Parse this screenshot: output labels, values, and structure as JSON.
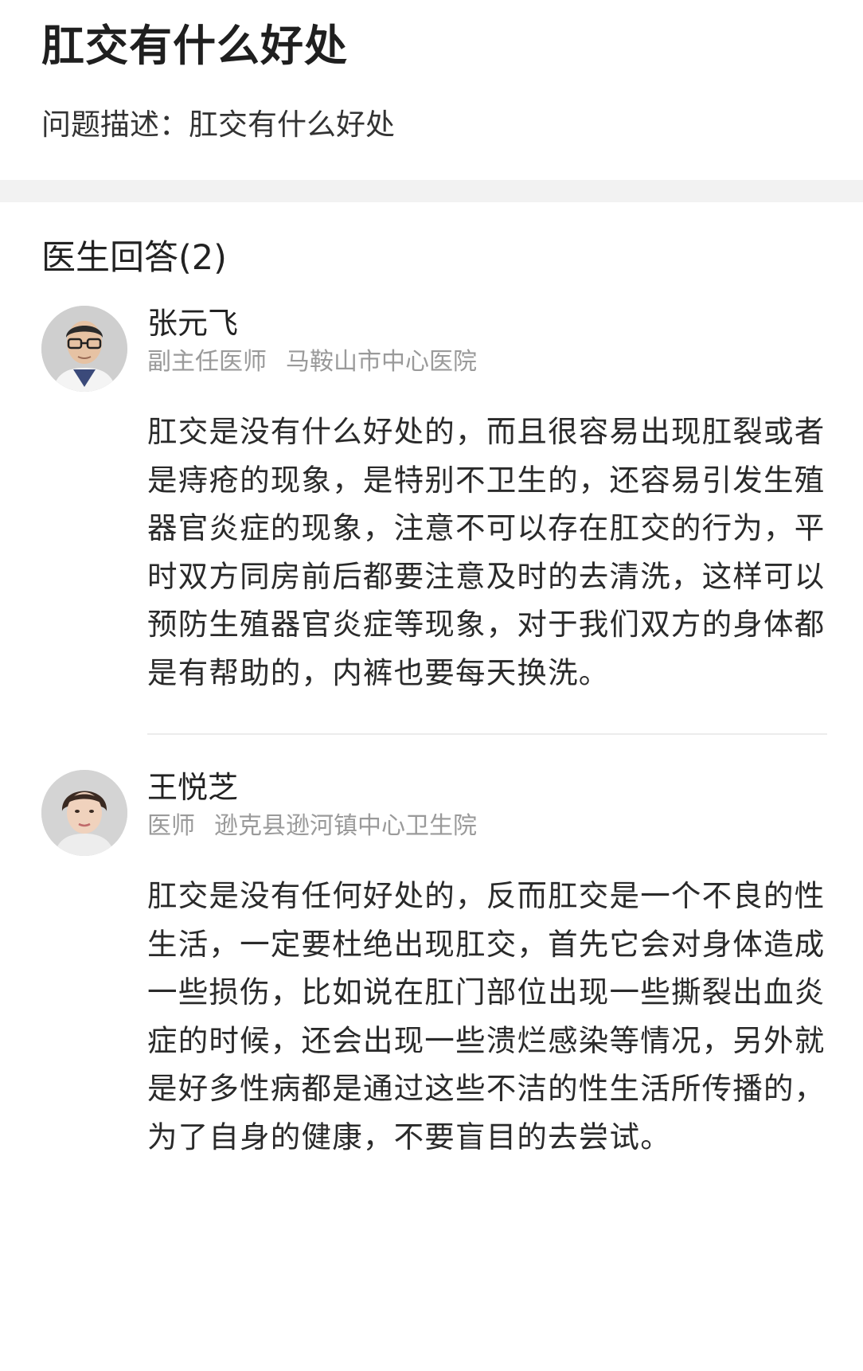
{
  "question": {
    "title": "肛交有什么好处",
    "description": "问题描述：肛交有什么好处"
  },
  "answers_section": {
    "header": "医生回答(2)"
  },
  "doctors": [
    {
      "name": "张元飞",
      "title": "副主任医师",
      "hospital": "马鞍山市中心医院",
      "answer": "肛交是没有什么好处的，而且很容易出现肛裂或者是痔疮的现象，是特别不卫生的，还容易引发生殖器官炎症的现象，注意不可以存在肛交的行为，平时双方同房前后都要注意及时的去清洗，这样可以预防生殖器官炎症等现象，对于我们双方的身体都是有帮助的，内裤也要每天换洗。"
    },
    {
      "name": "王悦芝",
      "title": "医师",
      "hospital": "逊克县逊河镇中心卫生院",
      "answer": "肛交是没有任何好处的，反而肛交是一个不良的性生活，一定要杜绝出现肛交，首先它会对身体造成一些损伤，比如说在肛门部位出现一些撕裂出血炎症的时候，还会出现一些溃烂感染等情况，另外就是好多性病都是通过这些不洁的性生活所传播的，为了自身的健康，不要盲目的去尝试。"
    }
  ],
  "colors": {
    "title": "#1f1f1f",
    "meta_gray": "#9a9a9a",
    "band": "#f2f2f2"
  }
}
